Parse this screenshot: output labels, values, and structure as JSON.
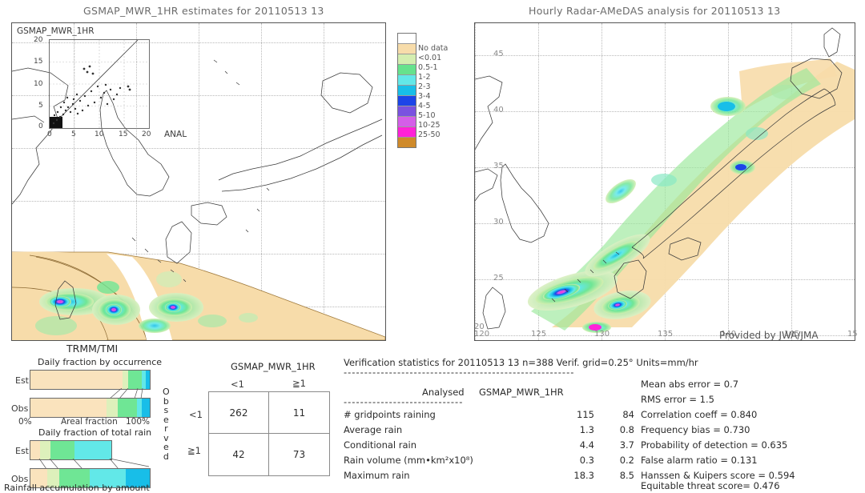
{
  "left_panel": {
    "title": "GSMAP_MWR_1HR estimates for 20110513 13",
    "inset_title": "GSMAP_MWR_1HR",
    "inset_xlabel": "ANAL",
    "inset_yticks": [
      "20",
      "15",
      "10",
      "5",
      "0"
    ],
    "inset_xticks": [
      "0",
      "5",
      "10",
      "15",
      "20"
    ],
    "source_label": "TRMM/TMI"
  },
  "right_panel": {
    "title": "Hourly Radar-AMeDAS analysis for 20110513 13",
    "credit": "Provided by JWA/JMA",
    "xticks": [
      "120",
      "125",
      "130",
      "135",
      "140",
      "145",
      "15"
    ],
    "yticks": [
      "45",
      "40",
      "35",
      "30",
      "25",
      "20"
    ]
  },
  "legend": {
    "labels": [
      "No data",
      "<0.01",
      "0.5-1",
      "1-2",
      "2-3",
      "3-4",
      "4-5",
      "5-10",
      "10-25",
      "25-50"
    ],
    "colors": [
      "#ffffff",
      "#f7dcaa",
      "#d4eeb0",
      "#66e28d",
      "#62e8e8",
      "#18bee8",
      "#1c45e8",
      "#7a52e0",
      "#d45ee8",
      "#ff22d8",
      "#cf8a2a"
    ]
  },
  "occurrence_chart": {
    "title": "Daily fraction by occurrence",
    "xlabel": "Areal fraction",
    "x_min": "0%",
    "x_max": "100%",
    "rows": [
      {
        "label": "Est",
        "segments": [
          {
            "color": "#fae3bd",
            "pct": 77.0
          },
          {
            "color": "#ddf0bb",
            "pct": 5.0
          },
          {
            "color": "#6fe695",
            "pct": 11.0
          },
          {
            "color": "#62e8e8",
            "pct": 4.0
          },
          {
            "color": "#18bee8",
            "pct": 3.0
          }
        ]
      },
      {
        "label": "Obs",
        "segments": [
          {
            "color": "#fae3bd",
            "pct": 64.0
          },
          {
            "color": "#ddf0bb",
            "pct": 9.0
          },
          {
            "color": "#6fe695",
            "pct": 16.0
          },
          {
            "color": "#62e8e8",
            "pct": 4.0
          },
          {
            "color": "#18bee8",
            "pct": 7.0
          }
        ]
      }
    ]
  },
  "total_rain_chart": {
    "title": "Daily fraction of total rain",
    "xlabel": "Rainfall accumulation by amount",
    "rows": [
      {
        "label": "Est",
        "width_pct": 68.0,
        "segments": [
          {
            "color": "#fae3bd",
            "pct": 12.0
          },
          {
            "color": "#ddf0bb",
            "pct": 13.0
          },
          {
            "color": "#6fe695",
            "pct": 29.0
          },
          {
            "color": "#62e8e8",
            "pct": 46.0
          }
        ]
      },
      {
        "label": "Obs",
        "width_pct": 100.0,
        "segments": [
          {
            "color": "#fae3bd",
            "pct": 14.0
          },
          {
            "color": "#ddf0bb",
            "pct": 10.0
          },
          {
            "color": "#6fe695",
            "pct": 26.0
          },
          {
            "color": "#62e8e8",
            "pct": 30.0
          },
          {
            "color": "#18bee8",
            "pct": 20.0
          }
        ]
      }
    ]
  },
  "contingency": {
    "title": "GSMAP_MWR_1HR",
    "col_headers": [
      "<1",
      "≧1"
    ],
    "row_headers": [
      "<1",
      "≧1"
    ],
    "row_axis_label": "Observed",
    "cells": [
      [
        "262",
        "11"
      ],
      [
        "42",
        "73"
      ]
    ]
  },
  "verification": {
    "header": "Verification statistics for 20110513 13  n=388  Verif. grid=0.25°  Units=mm/hr",
    "divider": "--------------------------------------------------------",
    "col_headers": [
      "Analysed",
      "GSMAP_MWR_1HR"
    ],
    "sub_divider": "-----------------------------",
    "rows": [
      {
        "name": "# gridpoints raining",
        "analysed": "115",
        "estimate": "84"
      },
      {
        "name": "Average rain",
        "analysed": "1.3",
        "estimate": "0.8"
      },
      {
        "name": "Conditional rain",
        "analysed": "4.4",
        "estimate": "3.7"
      },
      {
        "name": "Rain volume (mm•km²x10⁸)",
        "analysed": "0.3",
        "estimate": "0.2"
      },
      {
        "name": "Maximum rain",
        "analysed": "18.3",
        "estimate": "8.5"
      }
    ],
    "scores": [
      "Mean abs error = 0.7",
      "RMS error = 1.5",
      "Correlation coeff = 0.840",
      "Frequency bias = 0.730",
      "Probability of detection = 0.635",
      "False alarm ratio = 0.131",
      "Hanssen & Kuipers score = 0.594",
      "Equitable threat score= 0.476"
    ]
  }
}
